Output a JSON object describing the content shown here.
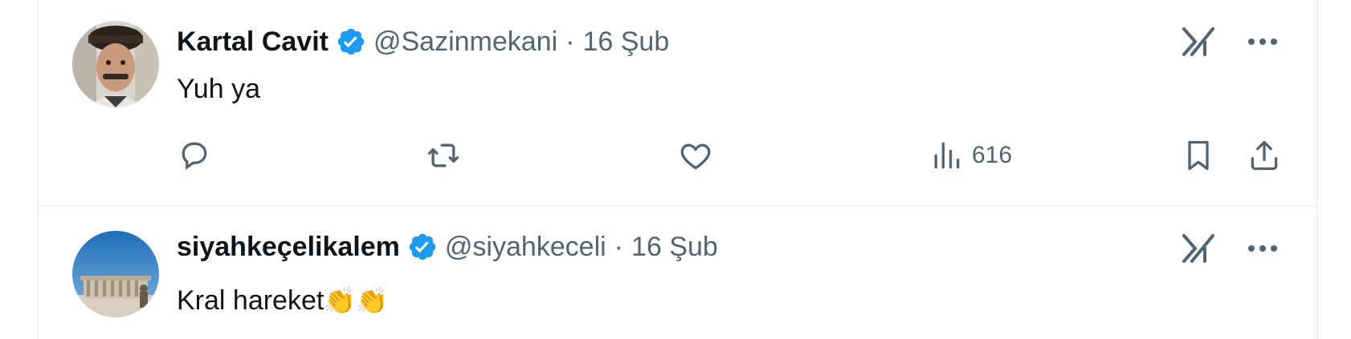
{
  "tweets": [
    {
      "name": "Kartal Cavit",
      "handle": "@Sazinmekani",
      "separator": "·",
      "date": "16 Şub",
      "text": "Yuh ya",
      "emoji": "",
      "views": "616"
    },
    {
      "name": "siyahkeçelikalem",
      "handle": "@siyahkeceli",
      "separator": "·",
      "date": "16 Şub",
      "text": "Kral hareket",
      "emoji": "👏👏"
    }
  ],
  "colors": {
    "text_primary": "#0f1419",
    "text_secondary": "#536471",
    "verified_blue": "#1d9bf0",
    "divider": "#eff3f4"
  },
  "icons": [
    "verified-badge-icon",
    "grok-icon",
    "more-icon",
    "reply-icon",
    "retweet-icon",
    "like-icon",
    "views-icon",
    "bookmark-icon",
    "share-icon"
  ]
}
